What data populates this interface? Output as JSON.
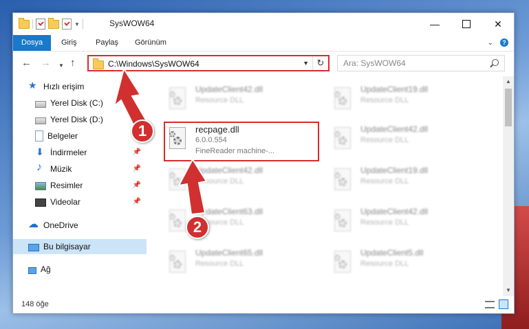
{
  "window": {
    "title": "SysWOW64"
  },
  "ribbon": {
    "tabs": [
      "Dosya",
      "Giriş",
      "Paylaş",
      "Görünüm"
    ]
  },
  "address": {
    "path": "C:\\Windows\\SysWOW64"
  },
  "search": {
    "placeholder": "Ara: SysWOW64"
  },
  "nav": {
    "items": [
      {
        "label": "Hızlı erişim",
        "icon": "star-icon"
      },
      {
        "label": "Yerel Disk (C:)",
        "icon": "disk-icon"
      },
      {
        "label": "Yerel Disk (D:)",
        "icon": "disk-icon"
      },
      {
        "label": "Belgeler",
        "icon": "documents-icon"
      },
      {
        "label": "İndirmeler",
        "icon": "downloads-icon"
      },
      {
        "label": "Müzik",
        "icon": "music-icon"
      },
      {
        "label": "Resimler",
        "icon": "pictures-icon"
      },
      {
        "label": "Videolar",
        "icon": "videos-icon"
      },
      {
        "label": "OneDrive",
        "icon": "onedrive-icon"
      },
      {
        "label": "Bu bilgisayar",
        "icon": "pc-icon"
      },
      {
        "label": "Ağ",
        "icon": "network-icon"
      }
    ]
  },
  "files": {
    "highlighted": {
      "name": "recpage.dll",
      "version": "6.0.0.554",
      "description": "FineReader machine-..."
    },
    "items": [
      {
        "name": "UpdateClient42.dll",
        "type": "Resource DLL"
      },
      {
        "name": "UpdateClient19.dll",
        "type": "Resource DLL"
      },
      {
        "name": "UpdateClient42.dll",
        "type": "Resource DLL"
      },
      {
        "name": "UpdateClient42.dll",
        "type": "Resource DLL"
      },
      {
        "name": "UpdateClient19.dll",
        "type": "Resource DLL"
      },
      {
        "name": "UpdateClient63.dll",
        "type": "Resource DLL"
      },
      {
        "name": "UpdateClient42.dll",
        "type": "Resource DLL"
      },
      {
        "name": "UpdateClient65.dll",
        "type": "Resource DLL"
      },
      {
        "name": "UpdateClient5.dll",
        "type": "Resource DLL"
      }
    ]
  },
  "status": {
    "count": "148 öğe"
  },
  "annotations": {
    "step1": "1",
    "step2": "2"
  },
  "colors": {
    "accent": "#1979ca",
    "highlight": "#d92a2a",
    "badge": "#d0302f"
  }
}
